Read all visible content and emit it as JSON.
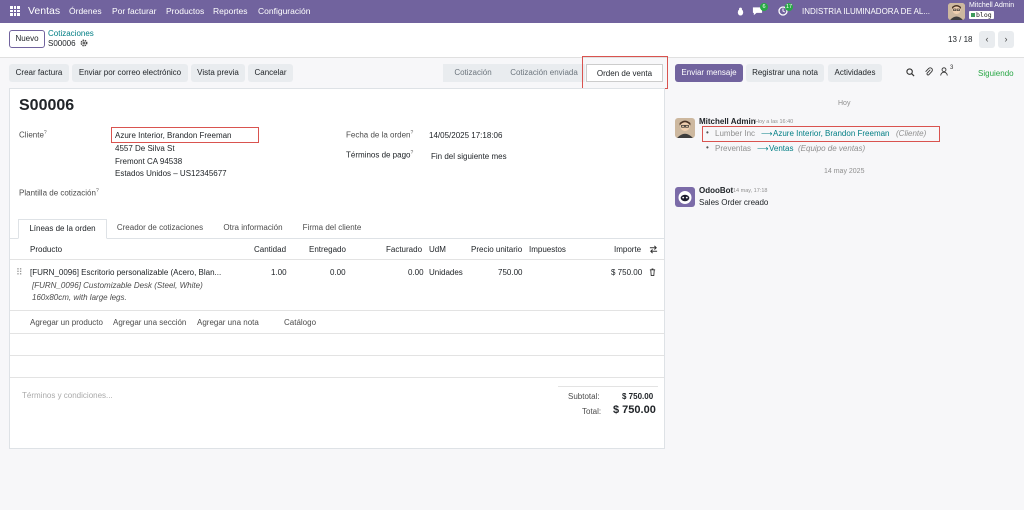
{
  "topnav": {
    "app_name": "Ventas",
    "menu": [
      "Órdenes",
      "Por facturar",
      "Productos",
      "Reportes",
      "Configuración"
    ],
    "activity_count": "6",
    "clock_count": "17",
    "company": "INDISTRIA ILUMINADORA DE AL...",
    "user_name": "Mitchell Admin",
    "user_db": "blog"
  },
  "control": {
    "new_label": "Nuevo",
    "breadcrumb_parent": "Cotizaciones",
    "record_name": "S00006",
    "pager": "13 / 18"
  },
  "actions": {
    "create_invoice": "Crear factura",
    "send_email": "Enviar por correo electrónico",
    "preview": "Vista previa",
    "cancel": "Cancelar"
  },
  "stages": [
    "Cotización",
    "Cotización enviada",
    "Orden de venta"
  ],
  "form": {
    "title": "S00006",
    "customer_label": "Cliente",
    "customer_name": "Azure Interior, Brandon Freeman",
    "address_1": "4557 De Silva St",
    "address_2": "Fremont CA 94538",
    "address_3": "Estados Unidos – US12345677",
    "template_label": "Plantilla de cotización",
    "order_date_label": "Fecha de la orden",
    "order_date": "14/05/2025 17:18:06",
    "payment_terms_label": "Términos de pago",
    "payment_terms": "Fin del siguiente mes"
  },
  "tabs": [
    "Líneas de la orden",
    "Creador de cotizaciones",
    "Otra información",
    "Firma del cliente"
  ],
  "table": {
    "headers": [
      "Producto",
      "Cantidad",
      "Entregado",
      "Facturado",
      "UdM",
      "Precio unitario",
      "Impuestos",
      "Importe"
    ],
    "row": {
      "product": "[FURN_0096] Escritorio personalizable (Acero, Blan...",
      "qty": "1.00",
      "delivered": "0.00",
      "invoiced": "0.00",
      "uom": "Unidades",
      "unit_price": "750.00",
      "taxes": "",
      "amount": "$ 750.00",
      "desc_1": "[FURN_0096] Customizable Desk (Steel, White)",
      "desc_2": "160x80cm, with large legs."
    },
    "add_links": [
      "Agregar un producto",
      "Agregar una sección",
      "Agregar una nota",
      "Catálogo"
    ]
  },
  "footer": {
    "terms_placeholder": "Términos y condiciones...",
    "subtotal_label": "Subtotal:",
    "subtotal": "$ 750.00",
    "total_label": "Total:",
    "total": "$ 750.00"
  },
  "chatter": {
    "send_message": "Enviar mensaje",
    "log_note": "Registrar una nota",
    "activities": "Actividades",
    "followers_count": "3",
    "following": "Siguiendo",
    "date_today": "Hoy",
    "msg1_author": "Mitchell Admin",
    "msg1_time": "Hoy a las 16:40",
    "msg1_old_customer": "Lumber Inc",
    "msg1_new_customer": "Azure Interior, Brandon Freeman",
    "msg1_field_customer": "(Cliente)",
    "msg1_old_team": "Preventas",
    "msg1_new_team": "Ventas",
    "msg1_field_team": "(Equipo de ventas)",
    "date_old": "14 may 2025",
    "msg2_author": "OdooBot",
    "msg2_time": "14 may, 17:18",
    "msg2_body": "Sales Order creado"
  },
  "colors": {
    "brand": "#71639e",
    "teal": "#017e84",
    "highlight": "#d9534f",
    "success": "#28a745"
  }
}
